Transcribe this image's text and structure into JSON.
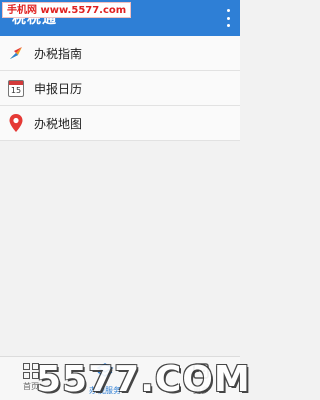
{
  "appbar": {
    "title": "税税通"
  },
  "watermark": {
    "top": "手机网 www.5577.com",
    "bottom": "5577.COM"
  },
  "menu": {
    "items": [
      {
        "label": "办税指南",
        "icon": "compass-icon"
      },
      {
        "label": "申报日历",
        "icon": "calendar-icon",
        "day": "15"
      },
      {
        "label": "办税地图",
        "icon": "map-pin-icon"
      }
    ]
  },
  "bottom_nav": {
    "items": [
      {
        "label": "首页",
        "icon": "grid-icon"
      },
      {
        "label": "办税服务",
        "icon": "tax-service-icon"
      },
      {
        "label": "更多",
        "icon": "more-icon"
      }
    ]
  },
  "colors": {
    "accent": "#2e7fd6",
    "pin": "#e53935"
  }
}
